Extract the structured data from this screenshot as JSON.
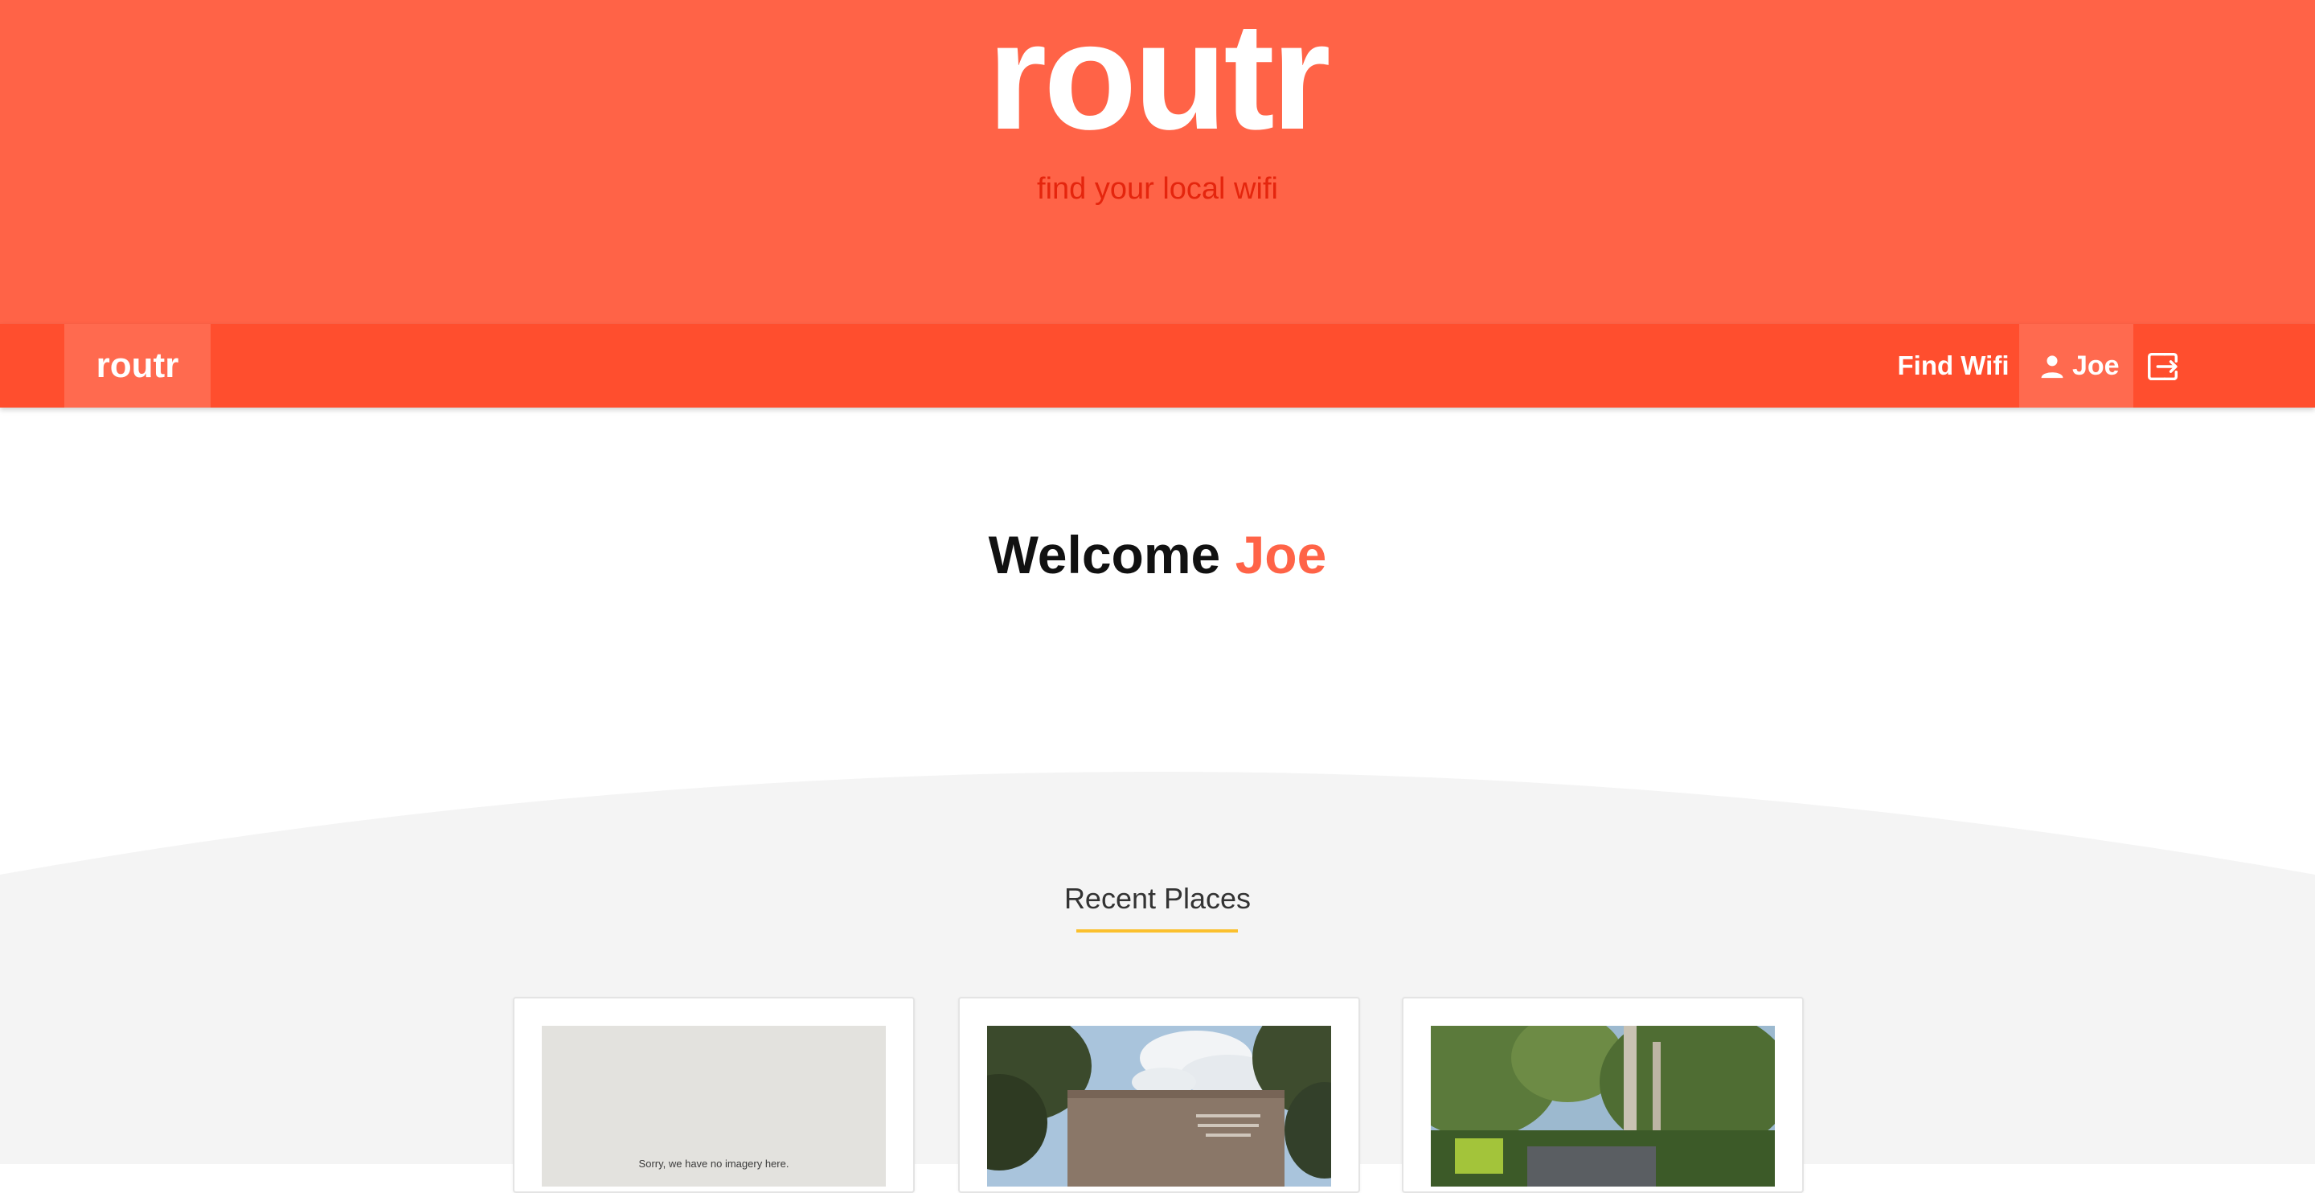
{
  "hero": {
    "title": "routr",
    "tagline": "find your local wifi"
  },
  "navbar": {
    "brand": "routr",
    "find_wifi": "Find Wifi",
    "user_name": "Joe",
    "user_icon": "person-icon",
    "logout_icon": "logout-icon"
  },
  "welcome": {
    "prefix": "Welcome",
    "name": "Joe"
  },
  "recent": {
    "title": "Recent Places",
    "cards": [
      {
        "image_text": "Sorry, we have no imagery here."
      },
      {
        "image_text": ""
      },
      {
        "image_text": ""
      }
    ]
  },
  "colors": {
    "hero": "#ff6347",
    "navbar": "#ff4e2e",
    "accent": "#ff6347",
    "underline": "#fbc02d",
    "section_bg": "#f4f4f4"
  }
}
